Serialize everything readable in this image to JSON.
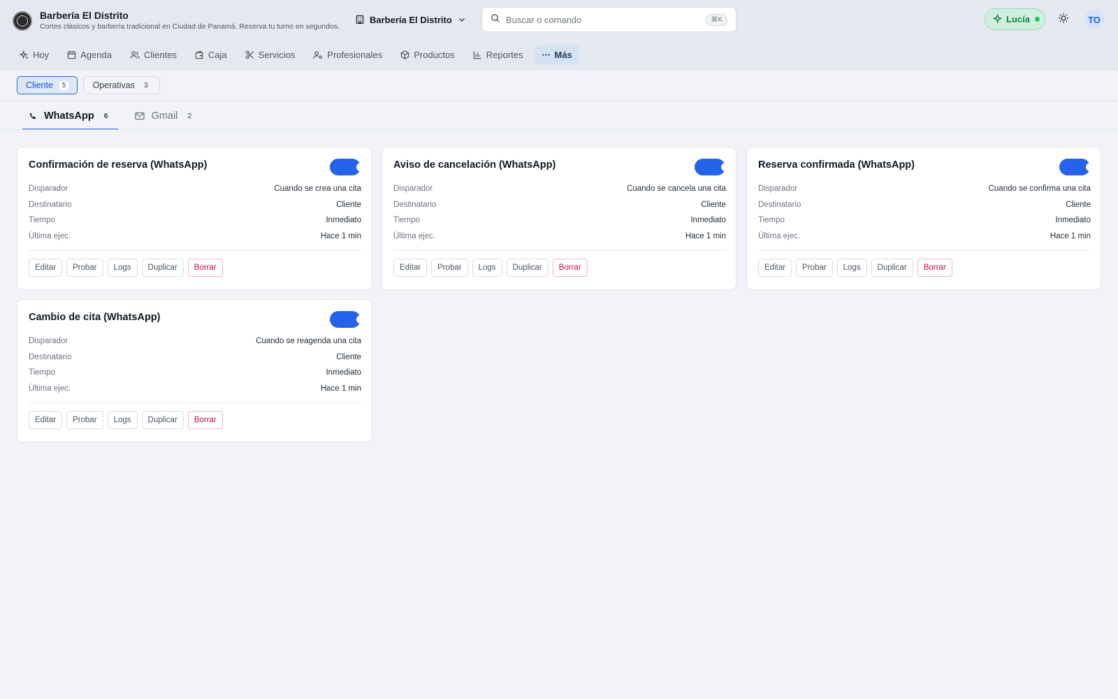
{
  "header": {
    "brand_title": "Barbería El Distrito",
    "brand_subtitle": "Cortes clásicos y barbería tradicional en Ciudad de Panamá. Reserva tu turno en segundos.",
    "business_selector": "Barbería El Distrito",
    "search_placeholder": "Buscar o comando",
    "search_shortcut": "⌘K",
    "assistant_label": "Lucía",
    "avatar_initials": "TO"
  },
  "nav": {
    "items": [
      {
        "label": "Hoy",
        "icon": "sparkle-icon"
      },
      {
        "label": "Agenda",
        "icon": "calendar-icon"
      },
      {
        "label": "Clientes",
        "icon": "users-icon"
      },
      {
        "label": "Caja",
        "icon": "wallet-icon"
      },
      {
        "label": "Servicios",
        "icon": "scissors-icon"
      },
      {
        "label": "Profesionales",
        "icon": "user-cog-icon"
      },
      {
        "label": "Productos",
        "icon": "box-icon"
      },
      {
        "label": "Reportes",
        "icon": "bar-chart-icon"
      },
      {
        "label": "Más",
        "icon": "more-icon",
        "active": true
      }
    ]
  },
  "subtabs": [
    {
      "label": "Cliente",
      "count": "5",
      "active": true
    },
    {
      "label": "Operativas",
      "count": "3",
      "active": false
    }
  ],
  "channel_tabs": [
    {
      "label": "WhatsApp",
      "count": "6",
      "icon": "phone-icon",
      "active": true
    },
    {
      "label": "Gmail",
      "count": "2",
      "icon": "mail-icon",
      "active": false
    }
  ],
  "labels": {
    "trigger": "Disparador",
    "recipient": "Destinatario",
    "timing": "Tiempo",
    "last_run": "Última ejec."
  },
  "actions": {
    "edit": "Editar",
    "test": "Probar",
    "logs": "Logs",
    "duplicate": "Duplicar",
    "delete": "Borrar"
  },
  "cards": [
    {
      "title": "Confirmación de reserva (WhatsApp)",
      "enabled": true,
      "trigger": "Cuando se crea una cita",
      "recipient": "Cliente",
      "timing": "Inmediato",
      "last_run": "Hace 1 min"
    },
    {
      "title": "Aviso de cancelación (WhatsApp)",
      "enabled": true,
      "trigger": "Cuando se cancela una cita",
      "recipient": "Cliente",
      "timing": "Inmediato",
      "last_run": "Hace 1 min"
    },
    {
      "title": "Reserva confirmada (WhatsApp)",
      "enabled": true,
      "trigger": "Cuando se confirma una cita",
      "recipient": "Cliente",
      "timing": "Inmediato",
      "last_run": "Hace 1 min"
    },
    {
      "title": "Cambio de cita (WhatsApp)",
      "enabled": true,
      "trigger": "Cuando se reagenda una cita",
      "recipient": "Cliente",
      "timing": "Inmediato",
      "last_run": "Hace 1 min"
    }
  ],
  "colors": {
    "accent": "#2563eb",
    "danger": "#be123c",
    "assistant_green": "#15803d"
  }
}
